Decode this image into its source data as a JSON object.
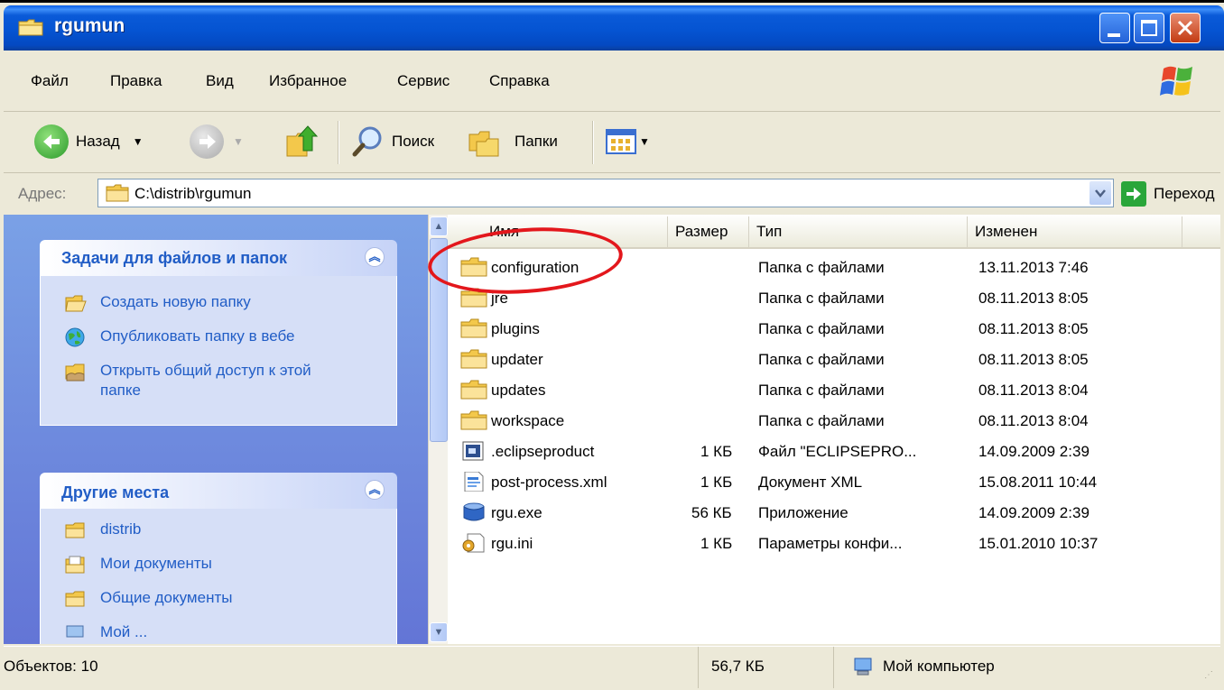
{
  "window": {
    "title": "rgumun",
    "colors": {
      "title_bg": "#0554d2",
      "close": "#c33b13",
      "task_blue": "#215dc6",
      "annotation": "#e3171c"
    }
  },
  "menu": {
    "items": [
      {
        "label": "Файл"
      },
      {
        "label": "Правка"
      },
      {
        "label": "Вид"
      },
      {
        "label": "Избранное"
      },
      {
        "label": "Сервис"
      },
      {
        "label": "Справка"
      }
    ]
  },
  "toolbar": {
    "back_label": "Назад",
    "search_label": "Поиск",
    "folders_label": "Папки",
    "icons": [
      "back-icon",
      "forward-icon",
      "up-folder-icon",
      "search-icon",
      "folders-icon",
      "views-icon"
    ]
  },
  "address": {
    "label": "Адрес:",
    "value": "C:\\distrib\\rgumun",
    "go_label": "Переход"
  },
  "tasks_panel": {
    "title": "Задачи для файлов и папок",
    "items": [
      {
        "label": "Создать новую папку",
        "icon": "new-folder-icon"
      },
      {
        "label": "Опубликовать папку в вебе",
        "icon": "publish-web-icon"
      },
      {
        "label": "Открыть общий доступ к этой папке",
        "icon": "share-folder-icon"
      }
    ]
  },
  "places_panel": {
    "title": "Другие места",
    "items": [
      {
        "label": "distrib",
        "icon": "folder-icon"
      },
      {
        "label": "Мои документы",
        "icon": "my-documents-icon"
      },
      {
        "label": "Общие документы",
        "icon": "folder-icon"
      },
      {
        "label": "Мой ...",
        "icon": "network-icon"
      }
    ]
  },
  "filelist": {
    "columns": [
      "Имя",
      "Размер",
      "Тип",
      "Изменен"
    ],
    "rows": [
      {
        "name": "configuration",
        "size": "",
        "type": "Папка с файлами",
        "modified": "13.11.2013 7:46",
        "icon": "folder-icon"
      },
      {
        "name": "jre",
        "size": "",
        "type": "Папка с файлами",
        "modified": "08.11.2013 8:05",
        "icon": "folder-icon"
      },
      {
        "name": "plugins",
        "size": "",
        "type": "Папка с файлами",
        "modified": "08.11.2013 8:05",
        "icon": "folder-icon"
      },
      {
        "name": "updater",
        "size": "",
        "type": "Папка с файлами",
        "modified": "08.11.2013 8:05",
        "icon": "folder-icon"
      },
      {
        "name": "updates",
        "size": "",
        "type": "Папка с файлами",
        "modified": "08.11.2013 8:04",
        "icon": "folder-icon"
      },
      {
        "name": "workspace",
        "size": "",
        "type": "Папка с файлами",
        "modified": "08.11.2013 8:04",
        "icon": "folder-icon"
      },
      {
        "name": ".eclipseproduct",
        "size": "1 КБ",
        "type": "Файл \"ECLIPSEPRO...",
        "modified": "14.09.2009 2:39",
        "icon": "file-icon"
      },
      {
        "name": "post-process.xml",
        "size": "1 КБ",
        "type": "Документ XML",
        "modified": "15.08.2011 10:44",
        "icon": "xml-file-icon"
      },
      {
        "name": "rgu.exe",
        "size": "56 КБ",
        "type": "Приложение",
        "modified": "14.09.2009 2:39",
        "icon": "exe-icon"
      },
      {
        "name": "rgu.ini",
        "size": "1 КБ",
        "type": "Параметры конфи...",
        "modified": "15.01.2010 10:37",
        "icon": "ini-file-icon"
      }
    ]
  },
  "status": {
    "objects": "Объектов: 10",
    "size": "56,7 КБ",
    "location": "Мой компьютер"
  }
}
